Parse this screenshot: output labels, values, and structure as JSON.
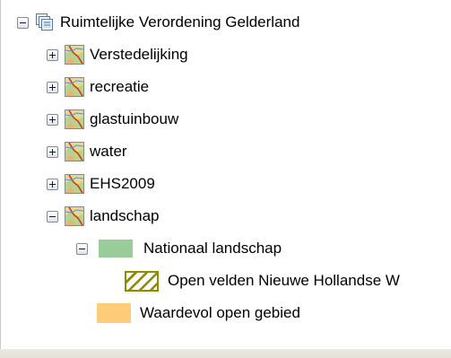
{
  "tree": {
    "root": {
      "label": "Ruimtelijke Verordening Gelderland",
      "expanded": true,
      "icon": "map-service-icon"
    },
    "layers": [
      {
        "label": "Verstedelijking",
        "expanded": false,
        "icon": "map-layer-icon"
      },
      {
        "label": "recreatie",
        "expanded": false,
        "icon": "map-layer-icon"
      },
      {
        "label": "glastuinbouw",
        "expanded": false,
        "icon": "map-layer-icon"
      },
      {
        "label": "water",
        "expanded": false,
        "icon": "map-layer-icon"
      },
      {
        "label": "EHS2009",
        "expanded": false,
        "icon": "map-layer-icon"
      },
      {
        "label": "landschap",
        "expanded": true,
        "icon": "map-layer-icon"
      }
    ],
    "legend": [
      {
        "label": "Nationaal landschap",
        "expanded": true,
        "swatch": "solid",
        "color": "#99cc99"
      },
      {
        "label": "Open velden Nieuwe Hollandse W",
        "swatch": "hatched",
        "color": "#8c8c00"
      },
      {
        "label": "Waardevol open gebied",
        "swatch": "solid",
        "color": "#ffcc77"
      }
    ]
  }
}
